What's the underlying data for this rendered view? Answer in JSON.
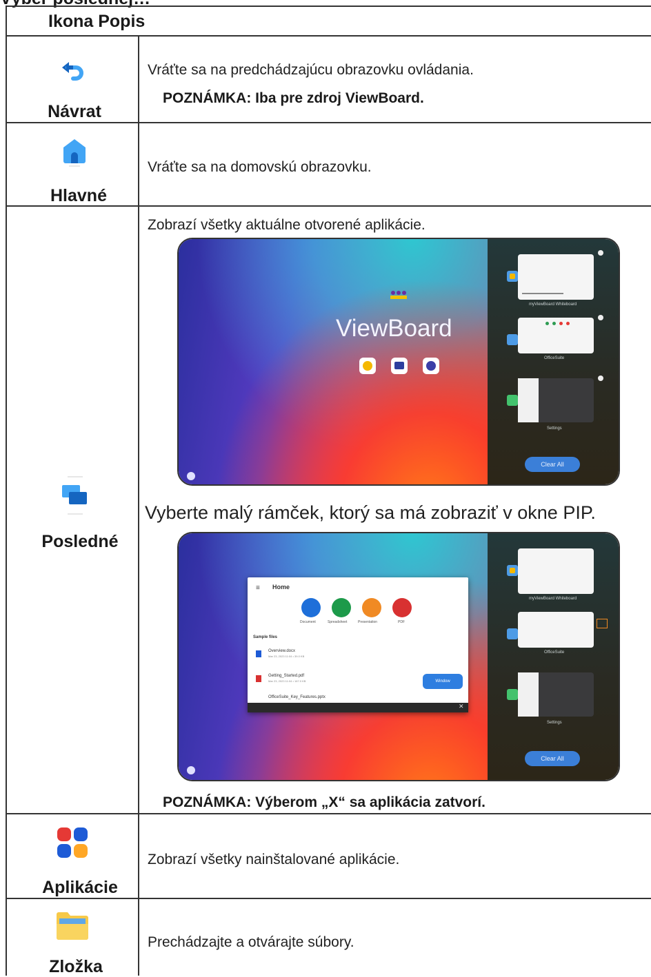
{
  "header": {
    "cut_title": "Výber poslednej…",
    "col_title": "Ikona Popis"
  },
  "rows": [
    {
      "label": "Návrat",
      "icon": "back-arrow-icon",
      "desc": "Vráťte sa na predchádzajúcu obrazovku ovládania.",
      "note": "POZNÁMKA: Iba pre zdroj ViewBoard."
    },
    {
      "label": "Hlavné",
      "icon": "home-icon",
      "desc": "Vráťte sa na domovskú obrazovku."
    },
    {
      "label": "Posledné",
      "icon": "recent-windows-icon",
      "desc": "Zobrazí všetky aktuálne otvorené aplikácie.",
      "desc2": "Vyberte malý rámček, ktorý sa má zobraziť v okne PIP.",
      "note": "POZNÁMKA: Výberom „X“ sa aplikácia zatvorí."
    },
    {
      "label": "Aplikácie",
      "icon": "apps-grid-icon",
      "desc": "Zobrazí všetky nainštalované aplikácie."
    },
    {
      "label": "Zložka",
      "icon": "folder-icon",
      "desc": "Prechádzajte a otvárajte súbory."
    }
  ],
  "screenshot1": {
    "brand": "ViewBoard",
    "recent_apps": [
      "myViewBoard Whiteboard",
      "OfficeSuite",
      "Settings"
    ],
    "clear_all": "Clear All"
  },
  "screenshot2": {
    "window_title": "Home",
    "app_tiles": [
      "Document",
      "Spreadsheet",
      "Presentation",
      "PDF"
    ],
    "sample_files_header": "Sample files",
    "files": [
      {
        "name": "Overview.docx",
        "meta": "Mar 23, 2023 11:04 • 39.0 KB"
      },
      {
        "name": "Getting_Started.pdf",
        "meta": "Mar 23, 2023 11:04 • 167.0 KB"
      },
      {
        "name": "OfficeSuite_Key_Features.pptx",
        "meta": ""
      }
    ],
    "windowed_button": "Window",
    "recent_apps": [
      "myViewBoard Whiteboard",
      "OfficeSuite",
      "Settings"
    ],
    "clear_all": "Clear All"
  },
  "colors": {
    "border": "#333333",
    "icon_blue": "#1565c0",
    "icon_light_blue": "#42a5f5",
    "apps_red": "#e53935",
    "apps_blue": "#1e5bd6",
    "apps_orange": "#ffa726",
    "folder_yellow": "#f7c948",
    "folder_stripe": "#5fa7e6"
  }
}
